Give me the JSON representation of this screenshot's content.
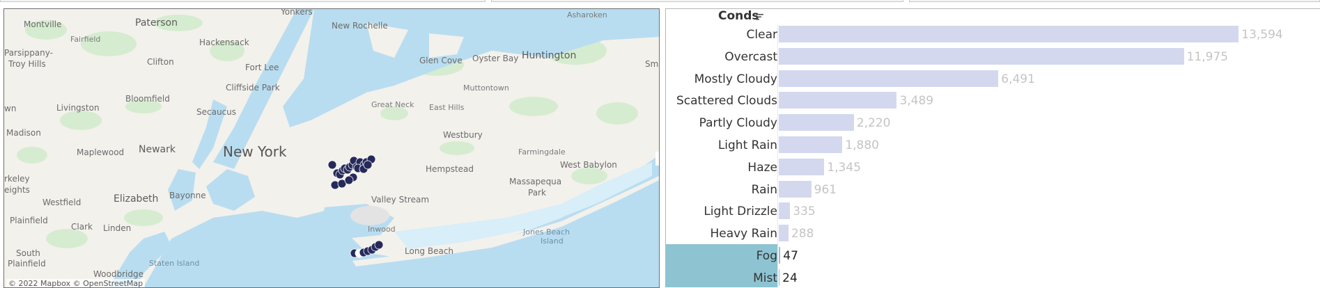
{
  "map": {
    "attribution": "© 2022 Mapbox © OpenStreetMap",
    "places": [
      {
        "name": "Yonkers",
        "size": "s"
      },
      {
        "name": "Asharoken",
        "size": "xs"
      },
      {
        "name": "Montville",
        "size": "s"
      },
      {
        "name": "Paterson",
        "size": "m"
      },
      {
        "name": "New Rochelle",
        "size": "s"
      },
      {
        "name": "Fairfield",
        "size": "xs"
      },
      {
        "name": "Hackensack",
        "size": "s"
      },
      {
        "name": "Parsippany-",
        "size": "s"
      },
      {
        "name": "Troy Hills",
        "size": "s"
      },
      {
        "name": "Clifton",
        "size": "s"
      },
      {
        "name": "Fort Lee",
        "size": "s"
      },
      {
        "name": "Glen Cove",
        "size": "s"
      },
      {
        "name": "Oyster Bay",
        "size": "s"
      },
      {
        "name": "Huntington",
        "size": "m"
      },
      {
        "name": "Sm",
        "size": "s"
      },
      {
        "name": "Cliffside Park",
        "size": "s"
      },
      {
        "name": "Muttontown",
        "size": "xs"
      },
      {
        "name": "Bloomfield",
        "size": "s"
      },
      {
        "name": "wn",
        "size": "s"
      },
      {
        "name": "Livingston",
        "size": "s"
      },
      {
        "name": "Secaucus",
        "size": "s"
      },
      {
        "name": "Great Neck",
        "size": "xs"
      },
      {
        "name": "East Hills",
        "size": "xs"
      },
      {
        "name": "Madison",
        "size": "s"
      },
      {
        "name": "Westbury",
        "size": "s"
      },
      {
        "name": "Maplewood",
        "size": "s"
      },
      {
        "name": "Newark",
        "size": "m"
      },
      {
        "name": "New York",
        "size": "l"
      },
      {
        "name": "Farmingdale",
        "size": "xs"
      },
      {
        "name": "West Babylon",
        "size": "s"
      },
      {
        "name": "Hempstead",
        "size": "s"
      },
      {
        "name": "rkeley",
        "size": "s"
      },
      {
        "name": "eights",
        "size": "s"
      },
      {
        "name": "Massapequa",
        "size": "s"
      },
      {
        "name": "Park",
        "size": "s"
      },
      {
        "name": "Westfield",
        "size": "s"
      },
      {
        "name": "Elizabeth",
        "size": "m"
      },
      {
        "name": "Bayonne",
        "size": "s"
      },
      {
        "name": "Valley Stream",
        "size": "s"
      },
      {
        "name": "Plainfield",
        "size": "s"
      },
      {
        "name": "Clark",
        "size": "s"
      },
      {
        "name": "Linden",
        "size": "s"
      },
      {
        "name": "Inwood",
        "size": "xs"
      },
      {
        "name": "Jones Beach",
        "size": "xs"
      },
      {
        "name": "Island",
        "size": "xs"
      },
      {
        "name": "South",
        "size": "s"
      },
      {
        "name": "Plainfield",
        "size": "s"
      },
      {
        "name": "Long Beach",
        "size": "s"
      },
      {
        "name": "Staten Island",
        "size": "xs"
      },
      {
        "name": "Woodbridge",
        "size": "s"
      }
    ],
    "marker_color": "#262a5a"
  },
  "chart_data": {
    "type": "bar",
    "orientation": "horizontal",
    "header": "Conds",
    "categories": [
      "Clear",
      "Overcast",
      "Mostly Cloudy",
      "Scattered Clouds",
      "Partly Cloudy",
      "Light Rain",
      "Haze",
      "Rain",
      "Light Drizzle",
      "Heavy Rain",
      "Fog",
      "Mist"
    ],
    "values": [
      13594,
      11975,
      6491,
      3489,
      2220,
      1880,
      1345,
      961,
      335,
      288,
      47,
      24
    ],
    "value_labels": [
      "13,594",
      "11,975",
      "6,491",
      "3,489",
      "2,220",
      "1,880",
      "1,345",
      "961",
      "335",
      "288",
      "47",
      "24"
    ],
    "highlighted": [
      "Fog",
      "Mist"
    ],
    "colors": {
      "bar": "#d3d8ee",
      "highlight": "#8ec3d2"
    },
    "xlim": [
      0,
      14000
    ]
  }
}
